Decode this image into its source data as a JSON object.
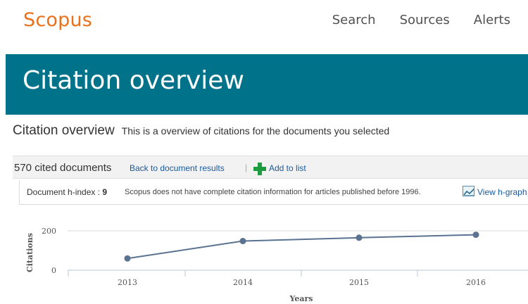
{
  "header": {
    "logo": "Scopus",
    "nav": [
      "Search",
      "Sources",
      "Alerts"
    ]
  },
  "banner": {
    "title": "Citation overview"
  },
  "subtitle": {
    "title": "Citation overview",
    "description": "This is a overview of citations for the documents you selected"
  },
  "toolbar": {
    "cited_count": "570 cited documents",
    "back_link": "Back to document results",
    "separator": "|",
    "add_to_list": "Add to list"
  },
  "hindex": {
    "label": "Document h-index :",
    "value": "9",
    "note": "Scopus does not have complete citation information for articles published before 1996.",
    "view_link": "View h-graph"
  },
  "colors": {
    "brand": "#e9711c",
    "banner": "#00738a",
    "link": "#1a5a9c",
    "series": "#5b7290"
  },
  "chart_data": {
    "type": "line",
    "x": [
      "2013",
      "2014",
      "2015",
      "2016"
    ],
    "series": [
      {
        "values": [
          60,
          148,
          165,
          180
        ]
      }
    ],
    "xlabel": "Years",
    "ylabel": "Citations",
    "yticks": [
      "0",
      "200"
    ],
    "ylim": [
      0,
      200
    ],
    "grid": true
  }
}
